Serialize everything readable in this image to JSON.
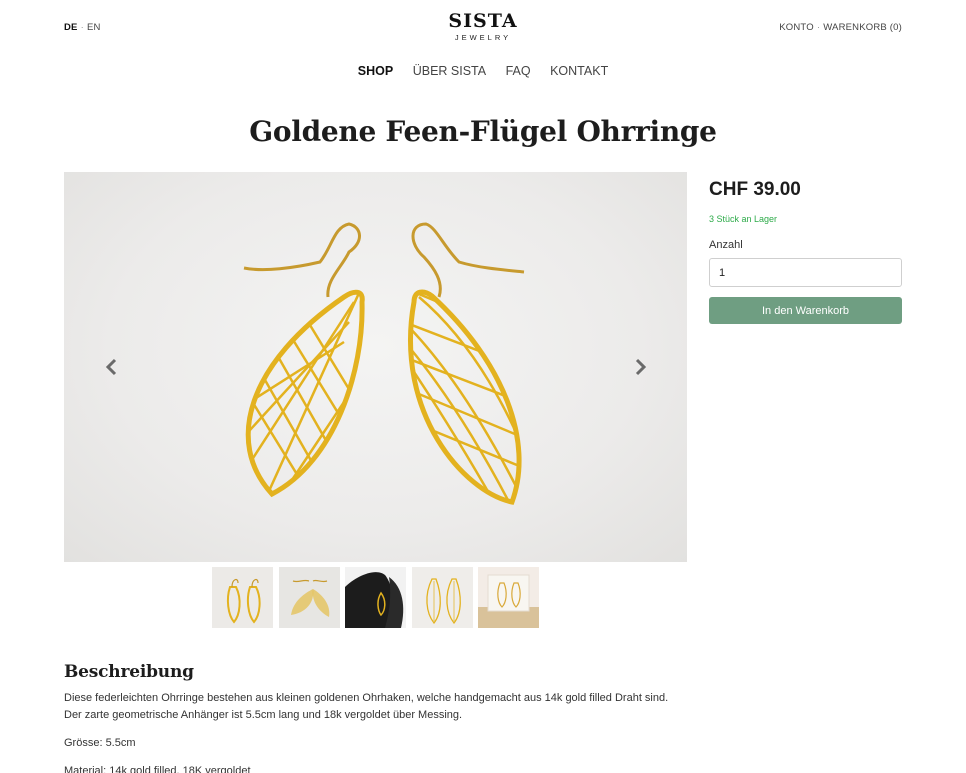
{
  "header": {
    "lang_active": "DE",
    "lang_other": "EN",
    "brand": "SISTA",
    "brand_sub": "JEWELRY",
    "account": "KONTO",
    "cart": "WARENKORB (0)"
  },
  "nav": {
    "items": [
      "SHOP",
      "ÜBER SISTA",
      "FAQ",
      "KONTAKT"
    ]
  },
  "product": {
    "title": "Goldene Feen-Flügel Ohrringe",
    "price": "CHF 39.00",
    "stock": "3 Stück an Lager",
    "qty_label": "Anzahl",
    "qty_value": "1",
    "add_to_cart": "In den Warenkorb"
  },
  "gallery": {
    "prev_icon": "chevron-left-icon",
    "next_icon": "chevron-right-icon"
  },
  "description": {
    "heading": "Beschreibung",
    "line1": "Diese federleichten Ohrringe bestehen aus kleinen goldenen Ohrhaken, welche handgemacht aus 14k gold filled Draht sind.",
    "line2": "Der zarte geometrische Anhänger ist 5.5cm lang und 18k vergoldet über Messing.",
    "size": "Grösse: 5.5cm",
    "material": "Material: 14k gold filled, 18K vergoldet"
  },
  "colors": {
    "accent": "#6f9e82",
    "stock_green": "#2eab4a",
    "gold": "#e3b21f"
  }
}
